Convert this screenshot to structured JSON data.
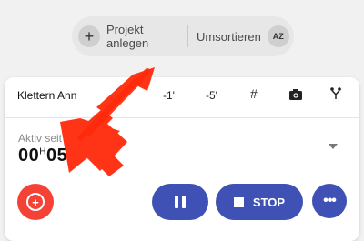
{
  "toolbar": {
    "add_project_label": "Projekt anlegen",
    "add_icon": "+",
    "reorder_label": "Umsortieren",
    "sort_icon": "AZ"
  },
  "card": {
    "project_name": "Klettern Ann",
    "actions": {
      "minus1": "-1'",
      "minus5": "-5'",
      "hash": "#"
    },
    "active_label": "Aktiv seit",
    "timer": {
      "hours": "00",
      "hours_unit": "H",
      "minutes": "05"
    }
  },
  "buttons": {
    "stop_label": "STOP",
    "more_icon": "•••"
  },
  "colors": {
    "accent": "#3f51b5",
    "alarm": "#f44336",
    "scribble": "#ff2a0a"
  },
  "icons": [
    "plus-icon",
    "sort-az-icon",
    "camera-icon",
    "fork-icon",
    "alarm-add-icon",
    "pause-icon",
    "stop-icon",
    "more-icon"
  ]
}
